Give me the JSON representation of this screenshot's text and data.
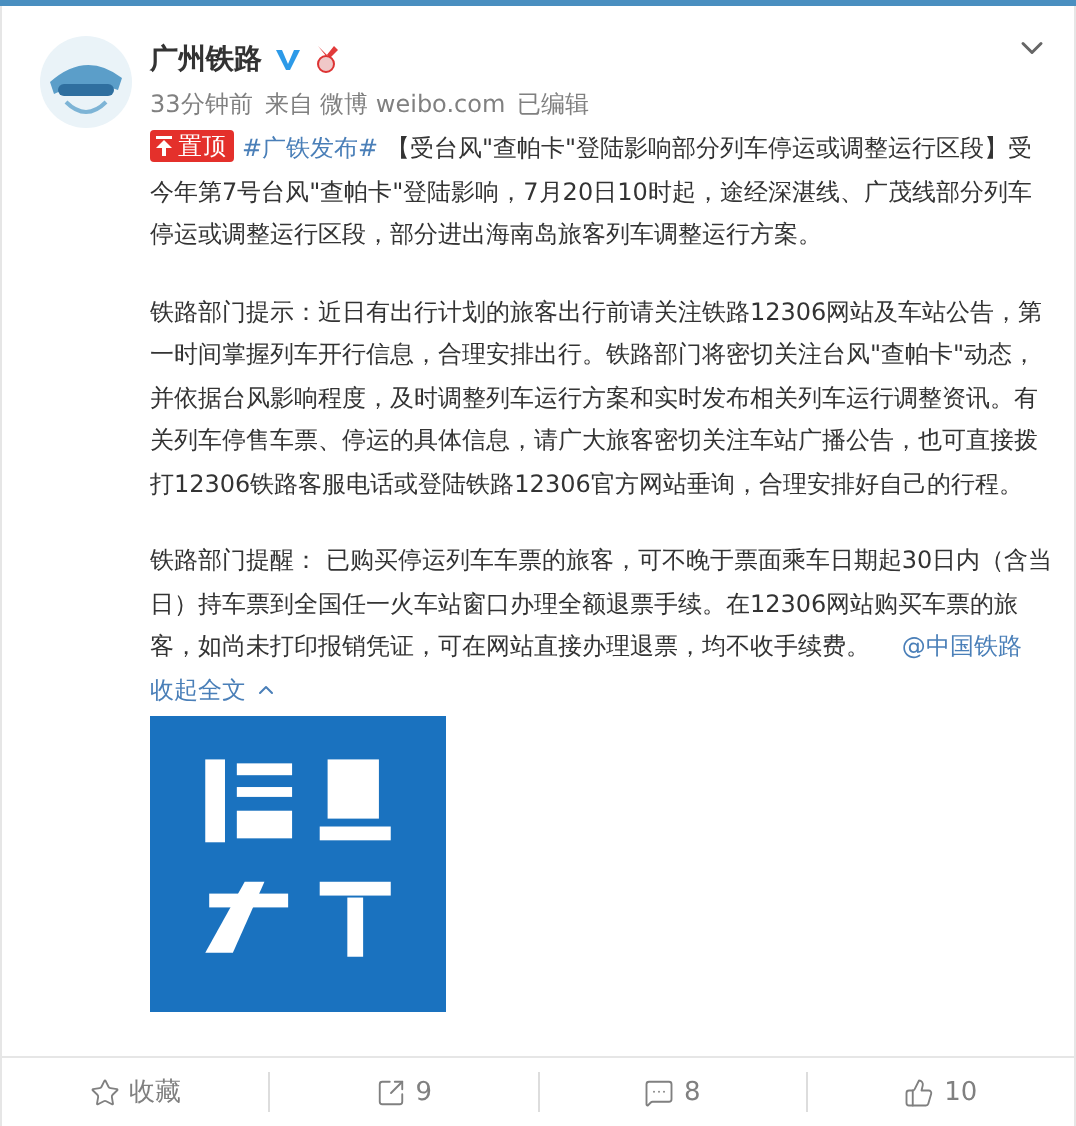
{
  "post": {
    "author": "广州铁路",
    "verified": true,
    "meta": {
      "time": "33分钟前",
      "source": "来自 微博 weibo.com",
      "edited": "已编辑"
    },
    "pinned_badge": "置顶",
    "hashtag": "#广铁发布#",
    "paragraphs": [
      {
        "text": "【受台风\"查帕卡\"登陆影响部分列车停运或调整运行区段】受今年第7号台风\"查帕卡\"登陆影响，7月20日10时起，途经深湛线、广茂线部分列车停运或调整运行区段，部分进出海南岛旅客列车调整运行方案。"
      },
      {
        "text": "铁路部门提示：近日有出行计划的旅客出行前请关注铁路12306网站及车站公告，第一时间掌握列车开行信息，合理安排出行。铁路部门将密切关注台风\"查帕卡\"动态，并依据台风影响程度，及时调整列车运行方案和实时发布相关列车运行调整资讯。有关列车停售车票、停运的具体信息，请广大旅客密切关注车站广播公告，也可直接拨打12306铁路客服电话或登陆铁路12306官方网站垂询，合理安排好自己的行程。"
      },
      {
        "text": "铁路部门提醒： 已购买停运列车车票的旅客，可不晚于票面乘车日期起30日内（含当日）持车票到全国任一火车站窗口办理全额退票手续。在12306网站购买车票的旅客，如尚未打印报销凭证，可在网站直接办理退票，均不收手续费。"
      }
    ],
    "mention": "@中国铁路",
    "collapse_link": "收起全文"
  },
  "actions": [
    {
      "kind": "favorite",
      "label": "收藏"
    },
    {
      "kind": "repost",
      "label": "9"
    },
    {
      "kind": "comment",
      "label": "8"
    },
    {
      "kind": "like",
      "label": "10"
    }
  ]
}
